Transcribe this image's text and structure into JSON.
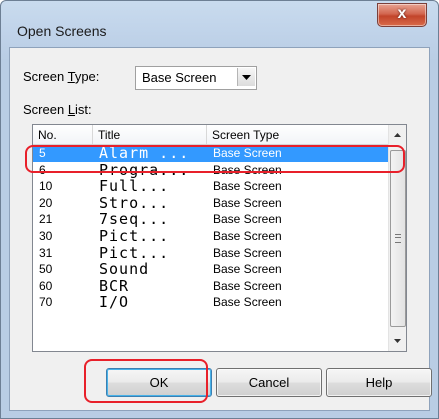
{
  "window": {
    "title": "Open Screens",
    "close_label": "x"
  },
  "screen_type": {
    "label_pre": "Screen ",
    "label_key": "T",
    "label_post": "ype:",
    "value": "Base Screen"
  },
  "screen_list": {
    "label_pre": "Screen ",
    "label_key": "L",
    "label_post": "ist:"
  },
  "columns": {
    "no": "No.",
    "title": "Title",
    "type": "Screen Type"
  },
  "rows": [
    {
      "no": "5",
      "title": "Alarm ...",
      "type": "Base Screen"
    },
    {
      "no": "6",
      "title": "Progra...",
      "type": "Base Screen"
    },
    {
      "no": "10",
      "title": "Full...",
      "type": "Base Screen"
    },
    {
      "no": "20",
      "title": "Stro...",
      "type": "Base Screen"
    },
    {
      "no": "21",
      "title": "7seq...",
      "type": "Base Screen"
    },
    {
      "no": "30",
      "title": "Pict...",
      "type": "Base Screen"
    },
    {
      "no": "31",
      "title": "Pict...",
      "type": "Base Screen"
    },
    {
      "no": "50",
      "title": "Sound",
      "type": "Base Screen"
    },
    {
      "no": "60",
      "title": "BCR",
      "type": "Base Screen"
    },
    {
      "no": "70",
      "title": "I/O",
      "type": "Base Screen"
    }
  ],
  "selected_row": 0,
  "buttons": {
    "ok": "OK",
    "cancel": "Cancel",
    "help": "Help"
  },
  "colors": {
    "selection": "#3399ff",
    "highlight": "#e8202a"
  },
  "icons": {
    "close": "close-icon",
    "dropdown": "chevron-down-icon",
    "scroll_up": "scroll-up-arrow-icon",
    "scroll_down": "scroll-down-arrow-icon"
  }
}
